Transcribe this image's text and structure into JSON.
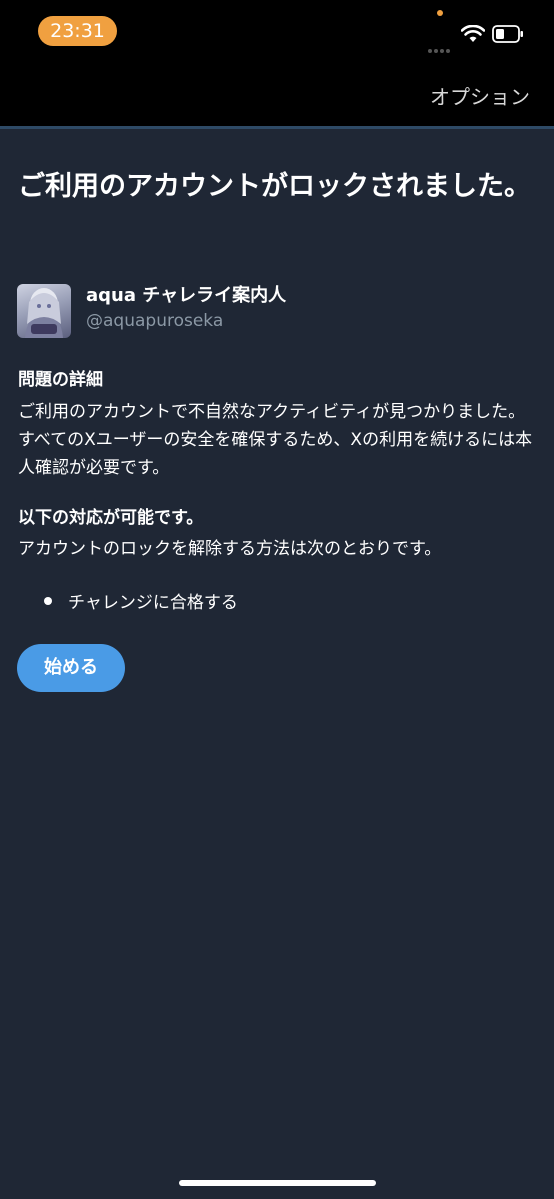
{
  "status_bar": {
    "time": "23:31",
    "accent_color": "#f0a040"
  },
  "nav": {
    "options_label": "オプション"
  },
  "title": "ご利用のアカウントがロックされました。",
  "account": {
    "display_name": "aqua チャレライ案内人",
    "handle": "@aquapuroseka"
  },
  "details": {
    "heading": "問題の詳細",
    "body": "ご利用のアカウントで不自然なアクティビティが見つかりました。すべてのXユーザーの安全を確保するため、Xの利用を続けるには本人確認が必要です。"
  },
  "actions": {
    "heading": "以下の対応が可能です。",
    "body": "アカウントのロックを解除する方法は次のとおりです。",
    "items": [
      "チャレンジに合格する"
    ]
  },
  "start_button_label": "始める",
  "colors": {
    "background": "#1f2735",
    "button": "#4a9be6",
    "handle_text": "#8b98a5"
  }
}
